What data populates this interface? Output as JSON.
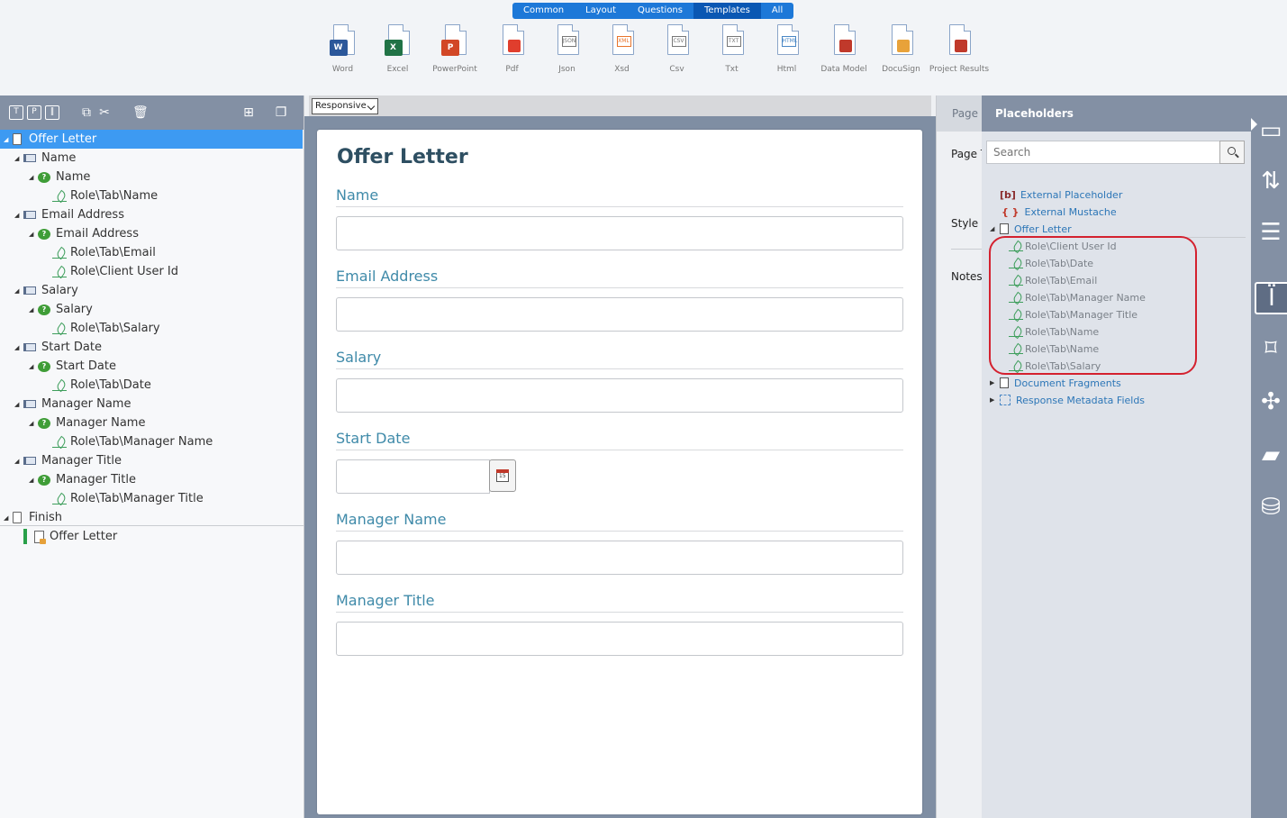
{
  "ribbon": {
    "tabs": [
      {
        "label": "Common",
        "active": false
      },
      {
        "label": "Layout",
        "active": false
      },
      {
        "label": "Questions",
        "active": false
      },
      {
        "label": "Templates",
        "active": true
      },
      {
        "label": "All",
        "active": false
      }
    ],
    "items": [
      {
        "label": "Word",
        "icon": "word-icon",
        "badge": "W",
        "color": "#2b579a"
      },
      {
        "label": "Excel",
        "icon": "excel-icon",
        "badge": "X",
        "color": "#217346"
      },
      {
        "label": "PowerPoint",
        "icon": "powerpoint-icon",
        "badge": "P",
        "color": "#d24726"
      },
      {
        "label": "Pdf",
        "icon": "pdf-icon",
        "badge": "",
        "color": "#e03e2d"
      },
      {
        "label": "Json",
        "icon": "json-icon",
        "tag": "JSON",
        "color": "#777777"
      },
      {
        "label": "Xsd",
        "icon": "xsd-icon",
        "tag": "XML",
        "color": "#e8742c"
      },
      {
        "label": "Csv",
        "icon": "csv-icon",
        "tag": "CSV",
        "color": "#777777"
      },
      {
        "label": "Txt",
        "icon": "txt-icon",
        "tag": "TXT",
        "color": "#777777"
      },
      {
        "label": "Html",
        "icon": "html-icon",
        "tag": "HTML",
        "color": "#4b88c5"
      },
      {
        "label": "Data Model",
        "icon": "database-icon",
        "badge": "",
        "color": "#c0392b"
      },
      {
        "label": "DocuSign",
        "icon": "docusign-icon",
        "badge": "",
        "color": "#e8a23a"
      },
      {
        "label": "Project Results",
        "icon": "project-results-icon",
        "badge": "",
        "color": "#c0392b"
      }
    ]
  },
  "toolbar_icons": [
    "text-block-icon",
    "page-icon",
    "columns-icon",
    "copy-icon",
    "cut-icon",
    "delete-icon",
    "add-page-icon",
    "duplicate-icon"
  ],
  "tree": [
    {
      "label": "Offer Letter",
      "type": "page",
      "level": 0,
      "selected": true
    },
    {
      "label": "Name",
      "type": "section",
      "level": 1
    },
    {
      "label": "Name",
      "type": "question",
      "level": 2
    },
    {
      "label": "Role\\Tab\\Name",
      "type": "placeholder",
      "level": 3
    },
    {
      "label": "Email Address",
      "type": "section",
      "level": 1
    },
    {
      "label": "Email Address",
      "type": "question",
      "level": 2
    },
    {
      "label": "Role\\Tab\\Email",
      "type": "placeholder",
      "level": 3
    },
    {
      "label": "Role\\Client User Id",
      "type": "placeholder",
      "level": 3
    },
    {
      "label": "Salary",
      "type": "section",
      "level": 1
    },
    {
      "label": "Salary",
      "type": "question",
      "level": 2
    },
    {
      "label": "Role\\Tab\\Salary",
      "type": "placeholder",
      "level": 3
    },
    {
      "label": "Start Date",
      "type": "section",
      "level": 1
    },
    {
      "label": "Start Date",
      "type": "question",
      "level": 2
    },
    {
      "label": "Role\\Tab\\Date",
      "type": "placeholder",
      "level": 3
    },
    {
      "label": "Manager Name",
      "type": "section",
      "level": 1
    },
    {
      "label": "Manager Name",
      "type": "question",
      "level": 2
    },
    {
      "label": "Role\\Tab\\Manager Name",
      "type": "placeholder",
      "level": 3
    },
    {
      "label": "Manager Title",
      "type": "section",
      "level": 1
    },
    {
      "label": "Manager Title",
      "type": "question",
      "level": 2
    },
    {
      "label": "Role\\Tab\\Manager Title",
      "type": "placeholder",
      "level": 3
    },
    {
      "label": "Finish",
      "type": "finish",
      "level": 0
    },
    {
      "label": "Offer Letter",
      "type": "output",
      "level": 1
    }
  ],
  "view_mode": "Responsive",
  "form": {
    "title": "Offer Letter",
    "questions": [
      {
        "label": "Name",
        "kind": "text"
      },
      {
        "label": "Email Address",
        "kind": "text"
      },
      {
        "label": "Salary",
        "kind": "text"
      },
      {
        "label": "Start Date",
        "kind": "date"
      },
      {
        "label": "Manager Name",
        "kind": "text"
      },
      {
        "label": "Manager Title",
        "kind": "text"
      }
    ]
  },
  "properties": {
    "header": "Page P",
    "labels": [
      "Page T",
      "Style",
      "Notes"
    ]
  },
  "placeholders": {
    "title": "Placeholders",
    "search_placeholder": "Search",
    "rows": [
      {
        "label": "External Placeholder",
        "kind": "external",
        "prefix": "[b]"
      },
      {
        "label": "External Mustache",
        "kind": "mustache",
        "prefix": "{ }"
      },
      {
        "label": "Offer Letter",
        "kind": "doc",
        "expanded": true
      },
      {
        "label": "Role\\Client User Id",
        "kind": "ph"
      },
      {
        "label": "Role\\Tab\\Date",
        "kind": "ph"
      },
      {
        "label": "Role\\Tab\\Email",
        "kind": "ph"
      },
      {
        "label": "Role\\Tab\\Manager Name",
        "kind": "ph"
      },
      {
        "label": "Role\\Tab\\Manager Title",
        "kind": "ph"
      },
      {
        "label": "Role\\Tab\\Name",
        "kind": "ph"
      },
      {
        "label": "Role\\Tab\\Name",
        "kind": "ph"
      },
      {
        "label": "Role\\Tab\\Salary",
        "kind": "ph"
      },
      {
        "label": "Document Fragments",
        "kind": "doc",
        "expanded": false
      },
      {
        "label": "Response Metadata Fields",
        "kind": "meta",
        "expanded": false
      }
    ]
  },
  "rail_icons": [
    "input-field-icon",
    "split-merge-icon",
    "list-icon",
    "placeholder-code-icon",
    "bookmark-icon",
    "expand-icon",
    "folder-icon",
    "database-edit-icon"
  ],
  "rail_active": "placeholder-code-icon",
  "colors": {
    "accent": "#1d78d8",
    "selected": "#3d9af2",
    "panel_header": "#8390a4",
    "form_label": "#3f8aa9",
    "highlight": "#d4212f"
  }
}
